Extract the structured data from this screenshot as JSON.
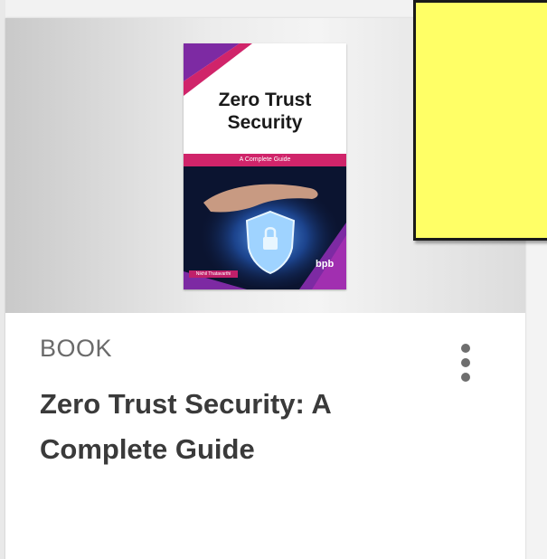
{
  "card": {
    "cover": {
      "title": "Zero Trust\nSecurity",
      "subtitle": "A Complete Guide",
      "author_band": "Nikhil Thatavarthi",
      "publisher": "bpb"
    },
    "content_type": "BOOK",
    "title": "Zero Trust Security: A Complete Guide",
    "more_button_icon": "kebab-menu-icon"
  },
  "colors": {
    "sticky_note": "#ffff66",
    "title_text": "#3a3a3a",
    "cover_magenta": "#d0246a"
  }
}
